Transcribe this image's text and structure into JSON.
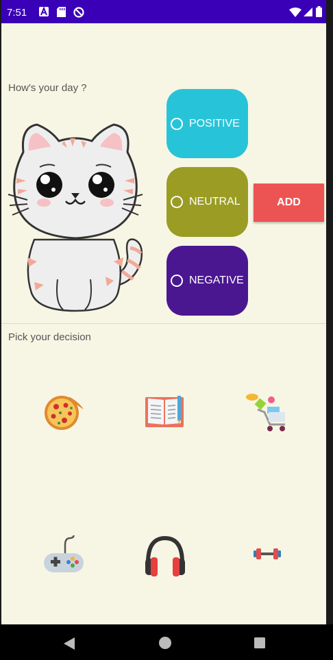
{
  "status_bar": {
    "time": "7:51",
    "left_icons": [
      "a-icon",
      "sd-card-icon",
      "dnd-icon"
    ],
    "right_icons": [
      "wifi-icon",
      "signal-icon",
      "battery-icon"
    ]
  },
  "mood_section": {
    "prompt": "How's your day ?",
    "options": [
      {
        "label": "POSITIVE",
        "color": "#27c4d9"
      },
      {
        "label": "NEUTRAL",
        "color": "#9a9c24"
      },
      {
        "label": "NEGATIVE",
        "color": "#4a1791"
      }
    ],
    "add_label": "ADD",
    "add_color": "#ec5453"
  },
  "decision_section": {
    "prompt": "Pick your decision",
    "icons": [
      "pizza-icon",
      "book-icon",
      "shopping-cart-icon",
      "gamepad-icon",
      "headphones-icon",
      "dumbbell-icon"
    ]
  },
  "theme": {
    "background": "#f7f6e4",
    "status_bar": "#3a00b8"
  }
}
